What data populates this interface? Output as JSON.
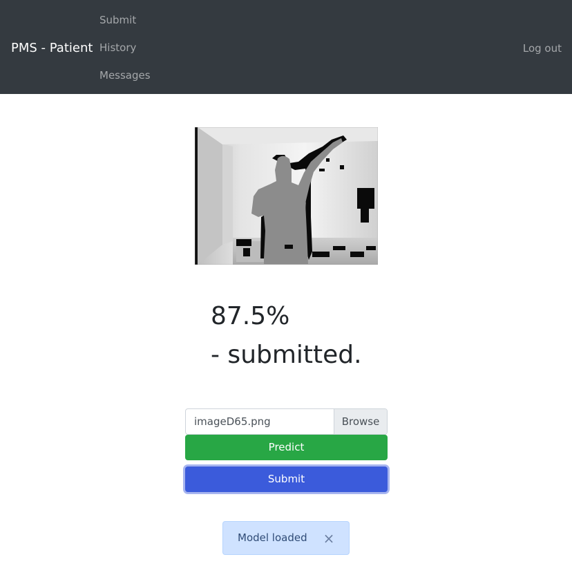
{
  "navbar": {
    "brand": "PMS - Patient",
    "links": [
      {
        "label": "Submit"
      },
      {
        "label": "History"
      },
      {
        "label": "Messages"
      }
    ],
    "logout": "Log out"
  },
  "result": {
    "percentage": "87.5%",
    "status": "- submitted."
  },
  "upload": {
    "file_name": "imageD65.png",
    "browse_label": "Browse"
  },
  "actions": {
    "predict_label": "Predict",
    "submit_label": "Submit"
  },
  "toast": {
    "message": "Model loaded",
    "close_glyph": "×"
  },
  "colors": {
    "navbar_bg": "#343a40",
    "predict": "#28a745",
    "submit": "#3b5bdb",
    "toast_bg": "#cfe2ff"
  }
}
